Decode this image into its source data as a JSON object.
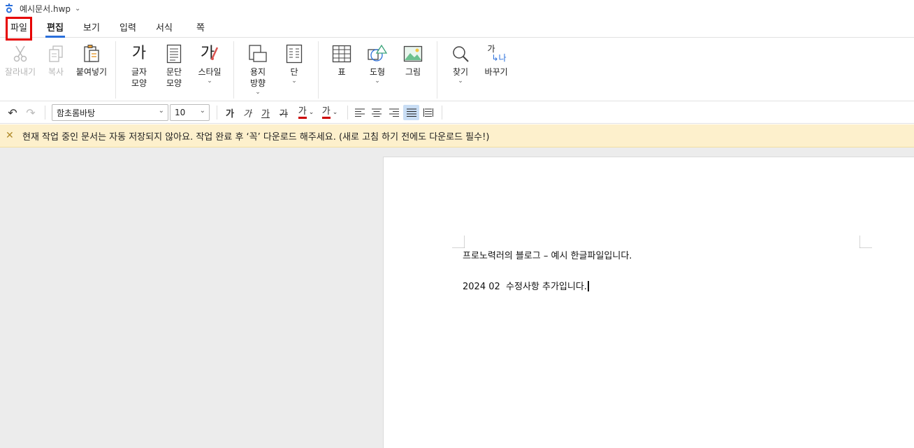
{
  "titlebar": {
    "filename": "예시문서.hwp"
  },
  "menu": {
    "tabs": [
      {
        "label": "파일"
      },
      {
        "label": "편집"
      },
      {
        "label": "보기"
      },
      {
        "label": "입력"
      },
      {
        "label": "서식"
      },
      {
        "label": "쪽"
      }
    ],
    "active_tab": "편집",
    "highlighted_tab": "파일"
  },
  "ribbon": {
    "cut": "잘라내기",
    "copy": "복사",
    "paste": "붙여넣기",
    "char_shape_l1": "글자",
    "char_shape_l2": "모양",
    "char_shape_glyph": "가",
    "para_shape_l1": "문단",
    "para_shape_l2": "모양",
    "style": "스타일",
    "style_glyph": "가",
    "page_orient_l1": "용지",
    "page_orient_l2": "방향",
    "column": "단",
    "table": "표",
    "shape": "도형",
    "picture": "그림",
    "find": "찾기",
    "replace": "바꾸기",
    "replace_glyph_top": "가",
    "replace_glyph_bottom": "나"
  },
  "format_toolbar": {
    "font": "함초롬바탕",
    "font_size": "10",
    "bold_glyph": "가",
    "italic_glyph": "가",
    "underline_glyph": "가",
    "strike_glyph": "가",
    "color_glyph": "가",
    "highlight_glyph": "가",
    "font_color": "#cc0000",
    "highlight_color": "#cc0000"
  },
  "banner": {
    "message": "현재 작업 중인 문서는 자동 저장되지 않아요. 작업 완료 후 ‘꼭’ 다운로드 해주세요. (새로 고침 하기 전에도 다운로드 필수!)"
  },
  "document": {
    "line1": "프로노력러의 블로그 – 예시 한글파일입니다.",
    "line2": "2024 02  수정사항 추가입니다."
  },
  "colors": {
    "accent": "#2a6fdb",
    "highlight_box": "#e60000",
    "banner_bg": "#fdf0cc"
  }
}
